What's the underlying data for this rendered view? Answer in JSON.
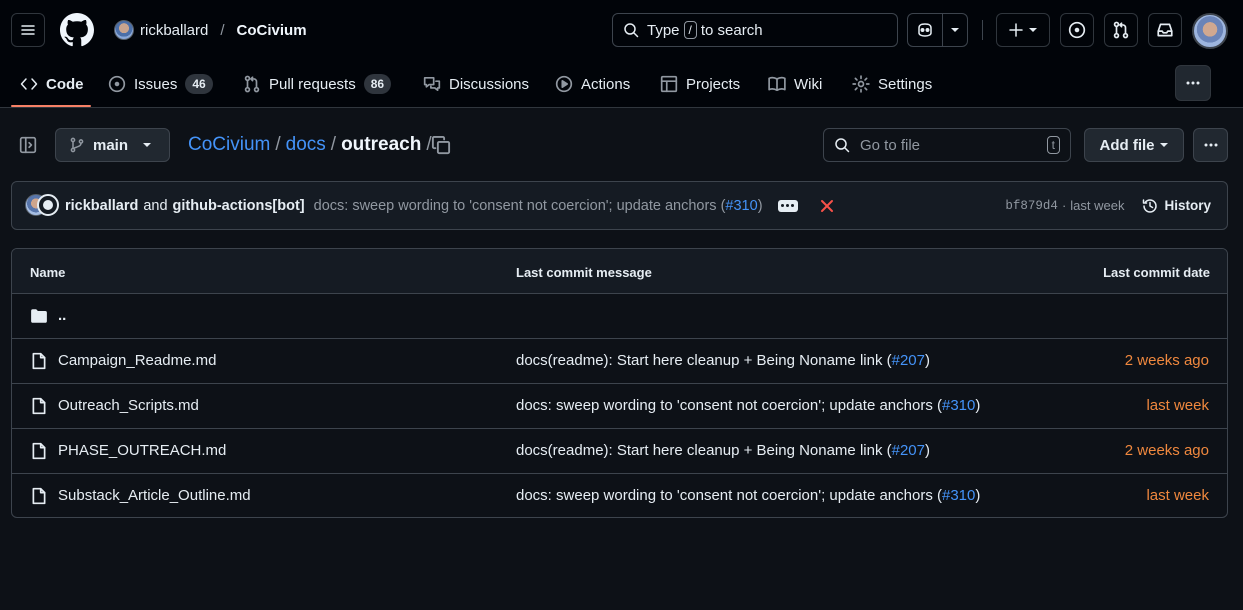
{
  "header": {
    "owner": "rickballard",
    "separator": "/",
    "repo": "CoCivium",
    "search": {
      "prefix": "Type",
      "key": "/",
      "suffix": "to search"
    }
  },
  "nav": {
    "tabs": [
      {
        "label": "Code",
        "icon": "code-icon",
        "active": true
      },
      {
        "label": "Issues",
        "icon": "issue-opened-icon",
        "count": "46"
      },
      {
        "label": "Pull requests",
        "icon": "git-pull-request-icon",
        "count": "86"
      },
      {
        "label": "Discussions",
        "icon": "comment-discussion-icon"
      },
      {
        "label": "Actions",
        "icon": "play-icon"
      },
      {
        "label": "Projects",
        "icon": "table-icon"
      },
      {
        "label": "Wiki",
        "icon": "book-icon"
      },
      {
        "label": "Settings",
        "icon": "gear-icon"
      }
    ]
  },
  "filenav": {
    "branch": "main",
    "crumbs": [
      "CoCivium",
      "docs"
    ],
    "current": "outreach",
    "trailing_sep": "/",
    "go_to_file": "Go to file",
    "go_to_file_key": "t",
    "add_file": "Add file"
  },
  "commit": {
    "author1": "rickballard",
    "and": "and",
    "author2": "github-actions[bot]",
    "message": "docs: sweep wording to 'consent not coercion'; update anchors (",
    "pr": "#310",
    "message_end": ")",
    "sha": "bf879d4",
    "dot": "·",
    "when": "last week",
    "history": "History",
    "status_color": "#f85149"
  },
  "table": {
    "headers": {
      "name": "Name",
      "message": "Last commit message",
      "date": "Last commit date"
    },
    "updir": "..",
    "rows": [
      {
        "name": "Campaign_Readme.md",
        "msg": "docs(readme): Start here cleanup + Being Noname link (",
        "pr": "#207",
        "end": ")",
        "date": "2 weeks ago"
      },
      {
        "name": "Outreach_Scripts.md",
        "msg": "docs: sweep wording to 'consent not coercion'; update anchors (",
        "pr": "#310",
        "end": ")",
        "date": "last week"
      },
      {
        "name": "PHASE_OUTREACH.md",
        "msg": "docs(readme): Start here cleanup + Being Noname link (",
        "pr": "#207",
        "end": ")",
        "date": "2 weeks ago"
      },
      {
        "name": "Substack_Article_Outline.md",
        "msg": "docs: sweep wording to 'consent not coercion'; update anchors (",
        "pr": "#310",
        "end": ")",
        "date": "last week"
      }
    ]
  },
  "colors": {
    "link": "#4493f8",
    "date": "#f0883e",
    "tab_underline": "#f78166",
    "background": "#0d1117"
  }
}
